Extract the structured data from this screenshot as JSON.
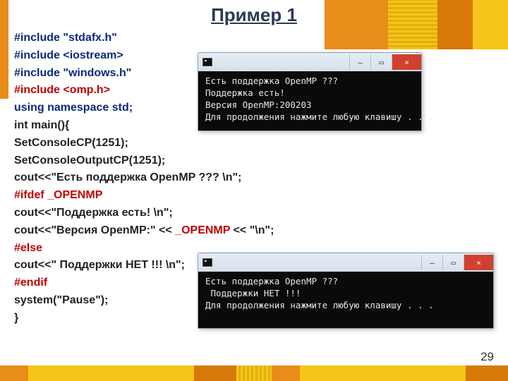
{
  "heading": "Пример 1",
  "page_number": "29",
  "code": {
    "l1": "#include \"stdafx.h\"",
    "l2": "#include <iostream>",
    "l3": "#include \"windows.h\"",
    "l4": "#include <omp.h>",
    "l5": "using namespace std;",
    "l6": "int main(){",
    "l7": "SetConsoleCP(1251);",
    "l8": "SetConsoleOutputCP(1251);",
    "l9": " cout<<\"Есть поддержка OpenMP ??? \\n\";",
    "l10": "#ifdef  _OPENMP",
    "l11": "cout<<\"Поддержка есть! \\n\";",
    "l12a": "cout<<\"Версия OpenMP:\" << ",
    "l12b": "_OPENMP",
    "l12c": " << \"\\n\";",
    "l13": "#else",
    "l14": " cout<<\" Поддержки НЕТ !!! \\n\";",
    "l15": "#endif",
    "l16": "system(\"Pause\");",
    "l17": "}"
  },
  "console1": {
    "icon_name": "console-icon",
    "minimize": "–",
    "maximize": "▭",
    "close": "×",
    "body": "Есть поддержка OpenMP ???\nПоддержка есть!\nВерсия OpenMP:200203\nДля продолжения нажмите любую клавишу . . ."
  },
  "console2": {
    "icon_name": "console-icon",
    "minimize": "–",
    "maximize": "▭",
    "close": "×",
    "body": "Есть поддержка OpenMP ???\n Поддержки НЕТ !!!\nДля продолжения нажмите любую клавишу . . ."
  }
}
